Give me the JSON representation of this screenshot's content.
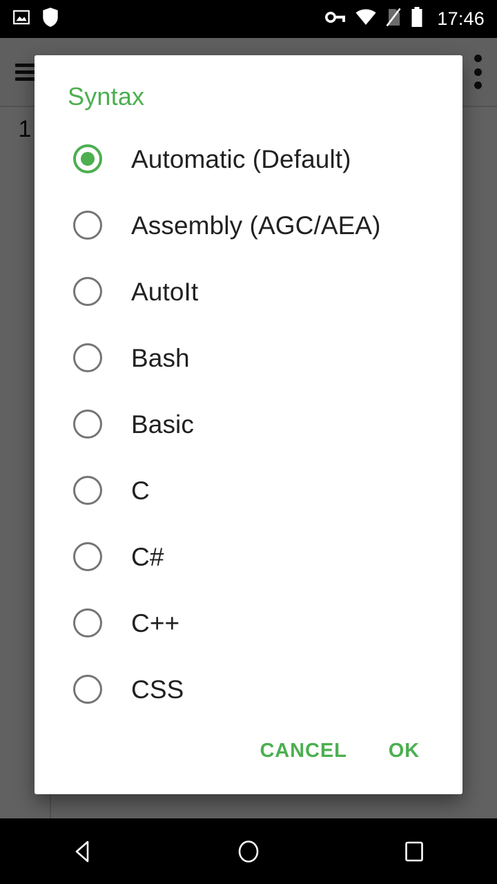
{
  "status_bar": {
    "left_icons": [
      "image-icon",
      "shield-icon"
    ],
    "right_icons": [
      "vpn-key-icon",
      "wifi-icon",
      "no-sim-icon",
      "battery-icon"
    ],
    "clock": "17:46"
  },
  "app_background": {
    "menu_icon": "hamburger-menu-icon",
    "overflow_icon": "overflow-menu-icon",
    "line_numbers": [
      "1"
    ]
  },
  "dialog": {
    "title": "Syntax",
    "selected_index": 0,
    "options": [
      {
        "label": "Automatic (Default)",
        "selected": true
      },
      {
        "label": "Assembly (AGC/AEA)",
        "selected": false
      },
      {
        "label": "AutoIt",
        "selected": false
      },
      {
        "label": "Bash",
        "selected": false
      },
      {
        "label": "Basic",
        "selected": false
      },
      {
        "label": "C",
        "selected": false
      },
      {
        "label": "C#",
        "selected": false
      },
      {
        "label": "C++",
        "selected": false
      },
      {
        "label": "CSS",
        "selected": false
      }
    ],
    "actions": {
      "cancel_label": "CANCEL",
      "ok_label": "OK"
    }
  },
  "nav_bar": {
    "back_icon": "back-triangle-icon",
    "home_icon": "home-circle-icon",
    "recents_icon": "recents-square-icon"
  },
  "colors": {
    "accent_green": "#4CAF50",
    "title_green": "#4CAF50",
    "radio_off": "#757575",
    "text_primary": "#212121",
    "dialog_bg": "#FFFFFF",
    "scrim": "rgba(0,0,0,0.62)",
    "status_bar_bg": "#000000"
  }
}
